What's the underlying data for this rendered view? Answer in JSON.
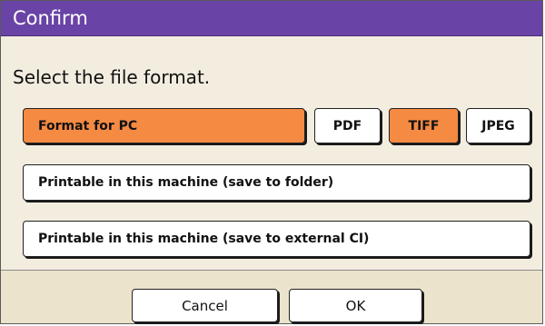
{
  "dialog": {
    "title": "Confirm",
    "prompt": "Select the file format.",
    "options": {
      "format_for_pc": "Format for PC",
      "printable_folder": "Printable in this machine (save to folder)",
      "printable_external": "Printable in this machine (save to external CI)"
    },
    "formats": {
      "pdf": "PDF",
      "tiff": "TIFF",
      "jpeg": "JPEG"
    },
    "selected_option": "Format for PC",
    "selected_format": "TIFF",
    "footer": {
      "cancel_label": "Cancel",
      "ok_label": "OK"
    }
  },
  "colors": {
    "title_bar": "#6a43a6",
    "selected": "#f58a43",
    "panel": "#f3ede0"
  }
}
